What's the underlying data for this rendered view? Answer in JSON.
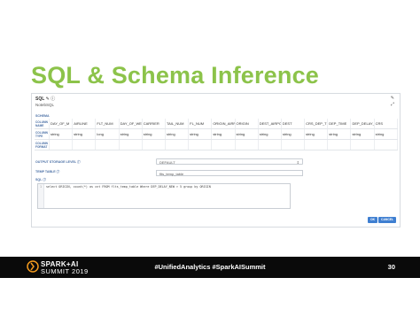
{
  "slide": {
    "title": "SQL & Schema Inference",
    "page_number": "30",
    "hashtags": "#UnifiedAnalytics #SparkAISummit"
  },
  "panel": {
    "title": "SQL",
    "subtitle": "NotebSQL",
    "schema_label": "SCHEMA",
    "row_labels": [
      "COLUMN NAME",
      "COLUMN TYPE",
      "COLUMN FORMAT"
    ],
    "columns": [
      {
        "name": "DAY_OF_M",
        "type": "string"
      },
      {
        "name": "AIRLINE",
        "type": "string"
      },
      {
        "name": "FLT_NUM",
        "type": "long"
      },
      {
        "name": "DAY_OF_WEEK",
        "type": "string"
      },
      {
        "name": "CARRIER",
        "type": "string"
      },
      {
        "name": "TAIL_NUM",
        "type": "string"
      },
      {
        "name": "FL_NUM",
        "type": "string"
      },
      {
        "name": "ORIGIN_AIRPORT_ID",
        "type": "string"
      },
      {
        "name": "ORIGIN",
        "type": "string"
      },
      {
        "name": "DEST_AIRPORT_ID",
        "type": "string"
      },
      {
        "name": "DEST",
        "type": "string"
      },
      {
        "name": "CRS_DEP_TIME",
        "type": "string"
      },
      {
        "name": "DEP_TIME",
        "type": "string"
      },
      {
        "name": "DEP_DELAY_NEW",
        "type": "string"
      },
      {
        "name": "CRS",
        "type": "string"
      }
    ],
    "output_storage_label": "OUTPUT STORAGE LEVEL",
    "output_storage_value": "DEFAULT",
    "temp_table_label": "TEMP TABLE",
    "temp_table_value": "flts_temp_table",
    "sql_label": "SQL",
    "sql_line_number": "1",
    "sql_code": "select ORIGIN, count(*) as cnt FROM flts_temp_table Where DEP_DELAY_NEW > 5 group by ORIGIN",
    "ok_label": "OK",
    "cancel_label": "CANCEL"
  },
  "branding": {
    "line1": "SPARK+AI",
    "line2": "SUMMIT 2019",
    "accent": "#8cc34a",
    "brand_orange": "#f39a1e",
    "button_blue": "#3f7fd1"
  }
}
